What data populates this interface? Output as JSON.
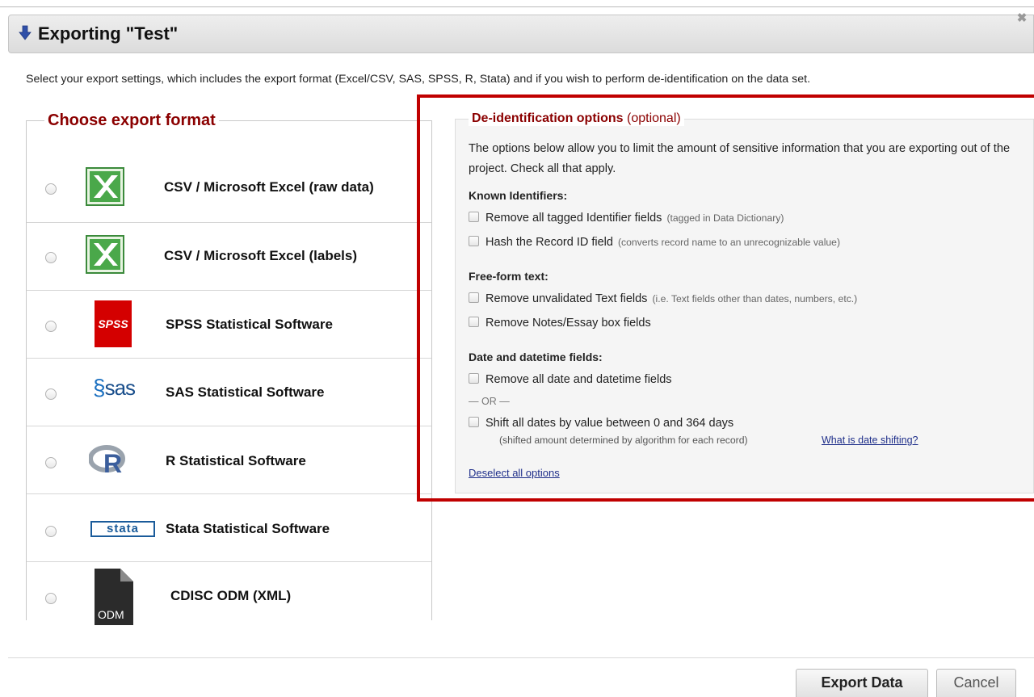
{
  "dialog": {
    "title": "Exporting \"Test\"",
    "close_label": "✖"
  },
  "intro": "Select your export settings, which includes the export format (Excel/CSV, SAS, SPSS, R, Stata) and if you wish to perform de-identification on the data set.",
  "formats": {
    "legend": "Choose export format",
    "items": [
      {
        "label": "CSV / Microsoft Excel (raw data)",
        "icon": "excel-icon"
      },
      {
        "label": "CSV / Microsoft Excel (labels)",
        "icon": "excel-icon"
      },
      {
        "label": "SPSS Statistical Software",
        "icon": "spss-logo-icon",
        "icon_text": "SPSS"
      },
      {
        "label": "SAS Statistical Software",
        "icon": "sas-logo-icon",
        "icon_text": "sas"
      },
      {
        "label": "R Statistical Software",
        "icon": "r-logo-icon",
        "icon_text": "R"
      },
      {
        "label": "Stata Statistical Software",
        "icon": "stata-logo-icon",
        "icon_text": "stata"
      },
      {
        "label": "CDISC ODM (XML)",
        "icon": "odm-file-icon",
        "icon_text": "ODM"
      }
    ]
  },
  "deid": {
    "legend": "De-identification options",
    "legend_optional": "(optional)",
    "description": "The options below allow you to limit the amount of sensitive information that you are exporting out of the project. Check all that apply.",
    "known_identifiers": {
      "heading": "Known Identifiers:",
      "remove_tagged": {
        "label": "Remove all tagged Identifier fields",
        "note": "(tagged in Data Dictionary)"
      },
      "hash_record": {
        "label": "Hash the Record ID field",
        "note": "(converts record name to an unrecognizable value)"
      }
    },
    "free_form": {
      "heading": "Free-form text:",
      "remove_unvalidated": {
        "label": "Remove unvalidated Text fields",
        "note": "(i.e. Text fields other than dates, numbers, etc.)"
      },
      "remove_notes": {
        "label": "Remove Notes/Essay box fields"
      }
    },
    "dates": {
      "heading": "Date and datetime fields:",
      "remove_dates": {
        "label": "Remove all date and datetime fields"
      },
      "or_text": "— OR —",
      "shift_dates": {
        "label": "Shift all dates by value between 0 and 364 days",
        "note": "(shifted amount determined by algorithm for each record)"
      },
      "what_link": "What is date shifting?"
    },
    "deselect_link": "Deselect all options"
  },
  "buttons": {
    "export": "Export Data",
    "cancel": "Cancel"
  },
  "colors": {
    "legend_red": "#8b0000",
    "highlight_box": "#c00000",
    "link_blue": "#1f2f8a"
  }
}
